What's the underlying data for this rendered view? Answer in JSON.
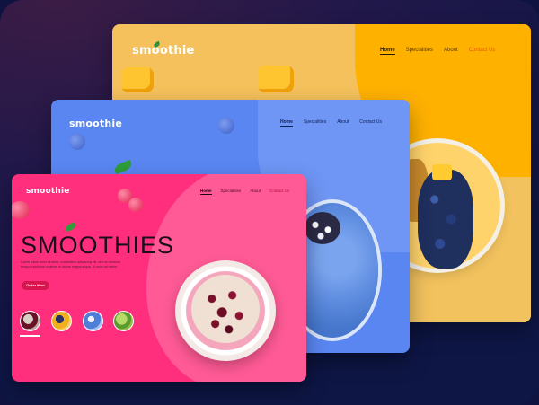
{
  "cards": {
    "yellow": {
      "logo": "smoothie",
      "nav": [
        "Home",
        "Specialities",
        "About",
        "Contact Us"
      ]
    },
    "blue": {
      "logo": "smoothie",
      "nav": [
        "Home",
        "Specialities",
        "About",
        "Contact Us"
      ]
    },
    "pink": {
      "logo": "smoothie",
      "nav": [
        "Home",
        "Specialities",
        "About",
        "Contact Us"
      ],
      "hero_title": "SMOOTHIES",
      "hero_desc": "Lorem ipsum dolor sit amet, consectetur adipiscing elit, sed do eiusmod tempor incididunt ut labore et dolore magna aliqua. Ut enim ad minim.",
      "cta": "Order Now"
    }
  },
  "colors": {
    "yellow_bg": "#f4c15c",
    "blue_bg": "#5a86f2",
    "pink_bg": "#ff2f7e",
    "accent_pink": "#d7164f"
  }
}
